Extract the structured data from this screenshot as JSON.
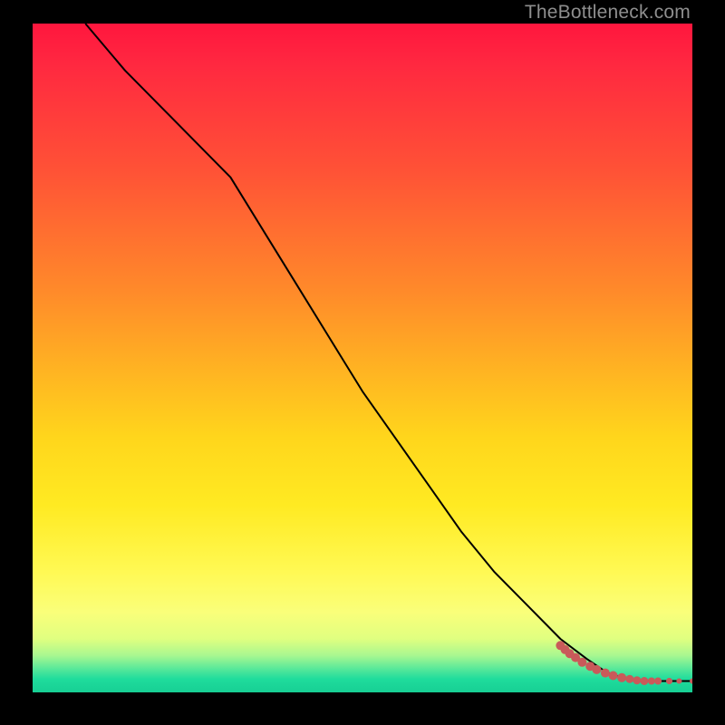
{
  "watermark": "TheBottleneck.com",
  "chart_data": {
    "type": "line",
    "title": "",
    "xlabel": "",
    "ylabel": "",
    "xlim": [
      0,
      100
    ],
    "ylim": [
      0,
      100
    ],
    "grid": false,
    "legend": false,
    "series": [
      {
        "name": "curve",
        "color": "#000000",
        "x": [
          8,
          14,
          20,
          25,
          30,
          35,
          40,
          45,
          50,
          55,
          60,
          65,
          70,
          75,
          80,
          84,
          87,
          90,
          94,
          100
        ],
        "y": [
          100,
          93,
          87,
          82,
          77,
          69,
          61,
          53,
          45,
          38,
          31,
          24,
          18,
          13,
          8,
          5,
          3,
          2,
          1.7,
          1.7
        ]
      }
    ],
    "scatter": {
      "name": "points",
      "color": "#c95a5a",
      "x": [
        80.0,
        80.7,
        81.4,
        82.3,
        83.3,
        84.5,
        85.5,
        86.8,
        88.0,
        89.3,
        90.5,
        91.6,
        92.7,
        93.8,
        94.8,
        96.5,
        98.0,
        100.0
      ],
      "y": [
        7.0,
        6.4,
        5.8,
        5.2,
        4.5,
        3.9,
        3.4,
        2.9,
        2.5,
        2.2,
        2.0,
        1.8,
        1.7,
        1.7,
        1.7,
        1.7,
        1.7,
        1.7
      ],
      "size": [
        10,
        10,
        10,
        10,
        10,
        10,
        10,
        10,
        10,
        10,
        9,
        9,
        9,
        8,
        8,
        7,
        6,
        6
      ]
    }
  }
}
